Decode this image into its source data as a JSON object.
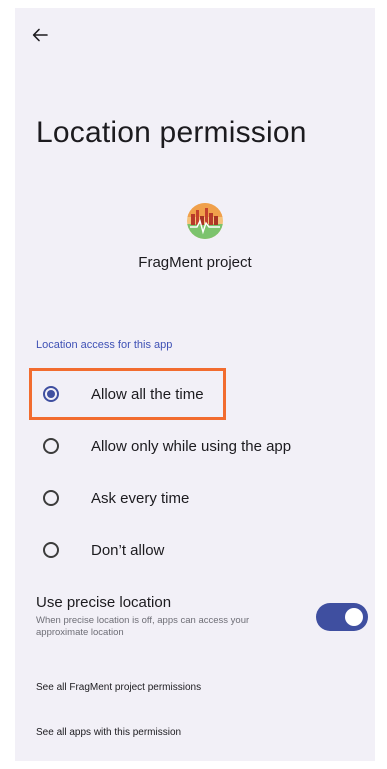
{
  "header": {
    "back_icon": "arrow-left-icon"
  },
  "page": {
    "title": "Location permission"
  },
  "app": {
    "name": "FragMent project",
    "icon": "app-logo-icon"
  },
  "section": {
    "label": "Location access for this app"
  },
  "options": [
    {
      "label": "Allow all the time",
      "selected": true
    },
    {
      "label": "Allow only while using the app",
      "selected": false
    },
    {
      "label": "Ask every time",
      "selected": false
    },
    {
      "label": "Don’t allow",
      "selected": false
    }
  ],
  "precise_location": {
    "title": "Use precise location",
    "description": "When precise location is off, apps can access your approximate location",
    "enabled": true
  },
  "links": {
    "app_permissions": "See all FragMent project permissions",
    "apps_with_permission": "See all apps with this permission"
  },
  "colors": {
    "accent": "#3f4fa0",
    "highlight": "#f26c2f",
    "background": "#f2f0f7"
  }
}
